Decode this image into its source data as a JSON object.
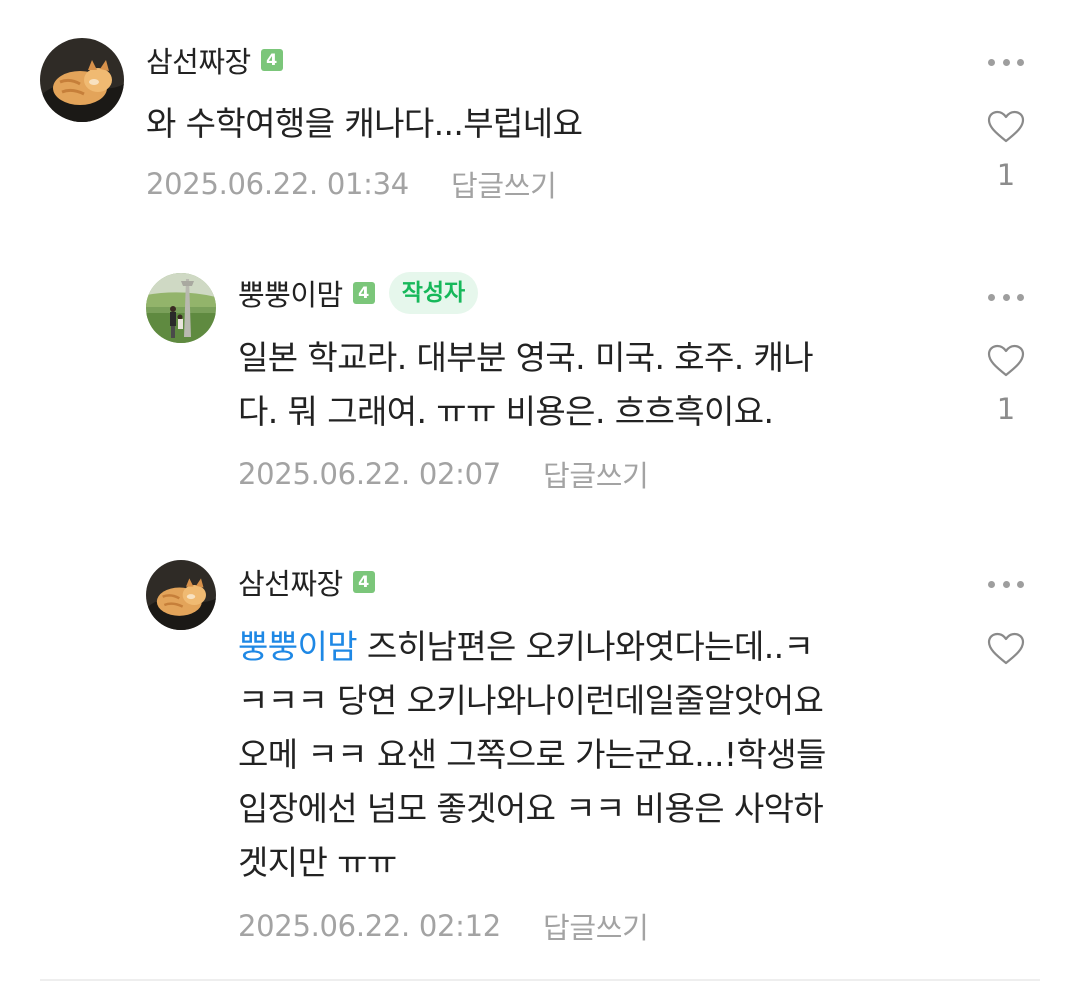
{
  "comments": [
    {
      "nickname": "삼선짜장",
      "level": "4",
      "lines": [
        "와 수학여행을 캐나다...부럽네요"
      ],
      "date": "2025.06.22. 01:34",
      "reply_label": "답글쓰기",
      "likes": "1",
      "avatar": "cat-avatar"
    },
    {
      "nickname": "뿡뿡이맘",
      "level": "4",
      "author_badge": "작성자",
      "lines": [
        "일본 학교라. 대부분 영국. 미국. 호주. 캐나",
        "다. 뭐 그래여. ㅠㅠ 비용은. 흐흐흑이요."
      ],
      "date": "2025.06.22. 02:07",
      "reply_label": "답글쓰기",
      "likes": "1",
      "avatar": "park-avatar"
    },
    {
      "nickname": "삼선짜장",
      "level": "4",
      "mention": "뿡뿡이맘",
      "first_line_rest": " 즈히남편은 오키나와엿다는데..ㅋ",
      "lines": [
        "ㅋㅋㅋ 당연 오키나와나이런데일줄알앗어요",
        "오메 ㅋㅋ 요샌 그쪽으로 가는군요...!학생들",
        "입장에선 넘모 좋겟어요 ㅋㅋ 비용은 사악하",
        "겟지만 ㅠㅠ"
      ],
      "date": "2025.06.22. 02:12",
      "reply_label": "답글쓰기",
      "avatar": "cat-avatar"
    }
  ],
  "colors": {
    "level_badge": "#7bc67a",
    "author_badge_bg": "#e6f7ec",
    "author_badge_text": "#16b85a",
    "mention": "#1e88e5",
    "meta": "#a3a3a3"
  },
  "icons": {
    "more": "more-horizontal-icon",
    "like": "heart-outline-icon"
  }
}
